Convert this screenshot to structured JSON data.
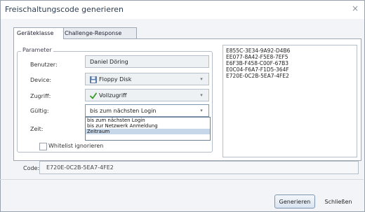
{
  "window": {
    "title": "Freischaltungscode generieren",
    "close_glyph": "×"
  },
  "tabs": [
    {
      "label": "Geräteklasse",
      "active": true
    },
    {
      "label": "Challenge-Response",
      "active": false
    }
  ],
  "params": {
    "legend": "Parameter",
    "benutzer_label": "Benutzer:",
    "benutzer_value": "Daniel Döring",
    "device_label": "Device:",
    "device_value": "Floppy Disk",
    "device_icon": "floppy-icon",
    "zugriff_label": "Zugriff:",
    "zugriff_value": "Vollzugriff",
    "zugriff_icon": "check-icon",
    "gueltig_label": "Gültig:",
    "gueltig_value": "bis zum nächsten Login",
    "zeit_label": "Zeit:",
    "whitelist_label": "Whitelist ignorieren"
  },
  "dropdown": {
    "options": [
      "bis zum nächsten Login",
      "bis zur Netzwerk Anmeldung",
      "Zeitraum"
    ],
    "selected_index": 2
  },
  "codes_list": [
    "E855C-3E34-9A92-D4B6",
    "EE077-8A42-F5E8-7EF5",
    "E6F3B-F458-C00F-67B3",
    "E0C04-F6A7-F1D5-364F",
    "E720E-0C2B-5EA7-4FE2"
  ],
  "code": {
    "label": "Code:",
    "value": "E720E-0C2B-5EA7-4FE2"
  },
  "buttons": {
    "generate": "Generieren",
    "close": "Schließen"
  },
  "colors": {
    "accent": "#7d97b3",
    "selection": "#c7d7ea",
    "check": "#3a9a2a"
  }
}
